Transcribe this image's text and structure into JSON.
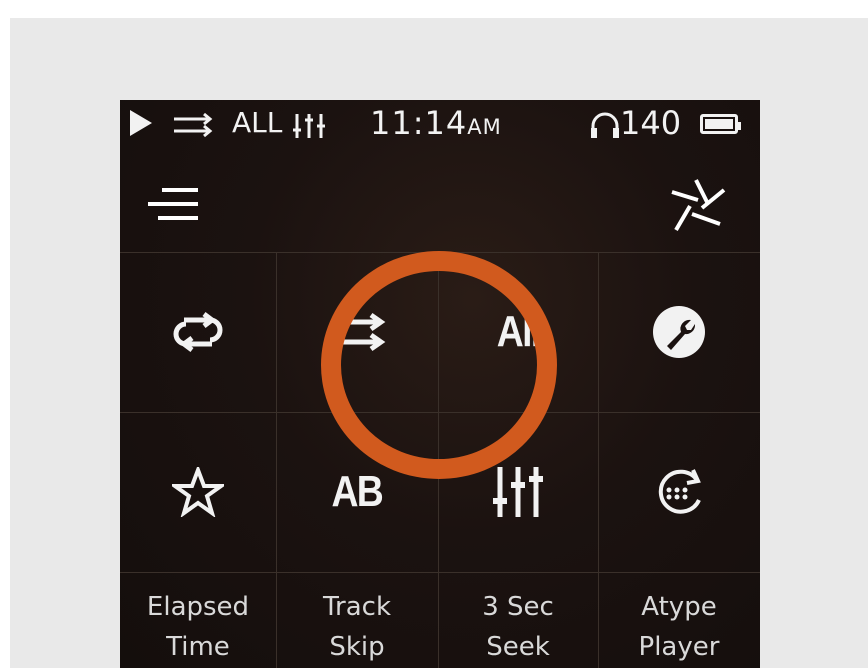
{
  "status_bar": {
    "all_label": "ALL",
    "time": "11:14",
    "ampm": "AM",
    "volume": "140"
  },
  "icons": {
    "row1": [
      "repeat-icon",
      "shuffle-icon",
      "play-all-icon",
      "settings-wrench-icon"
    ],
    "row2": [
      "favorite-star-icon",
      "ab-repeat-icon",
      "equalizer-icon",
      "atype-player-icon"
    ]
  },
  "grid_glyphs": {
    "play_all": "All",
    "ab_repeat": "AB"
  },
  "labels": [
    {
      "line1": "Elapsed",
      "line2": "Time"
    },
    {
      "line1": "Track",
      "line2": "Skip"
    },
    {
      "line1": "3 Sec",
      "line2": "Seek"
    },
    {
      "line1": "Atype",
      "line2": "Player"
    }
  ],
  "colors": {
    "highlight_ring": "#d15a1e",
    "foreground": "#f2f2f2",
    "background": "#1b1210"
  }
}
